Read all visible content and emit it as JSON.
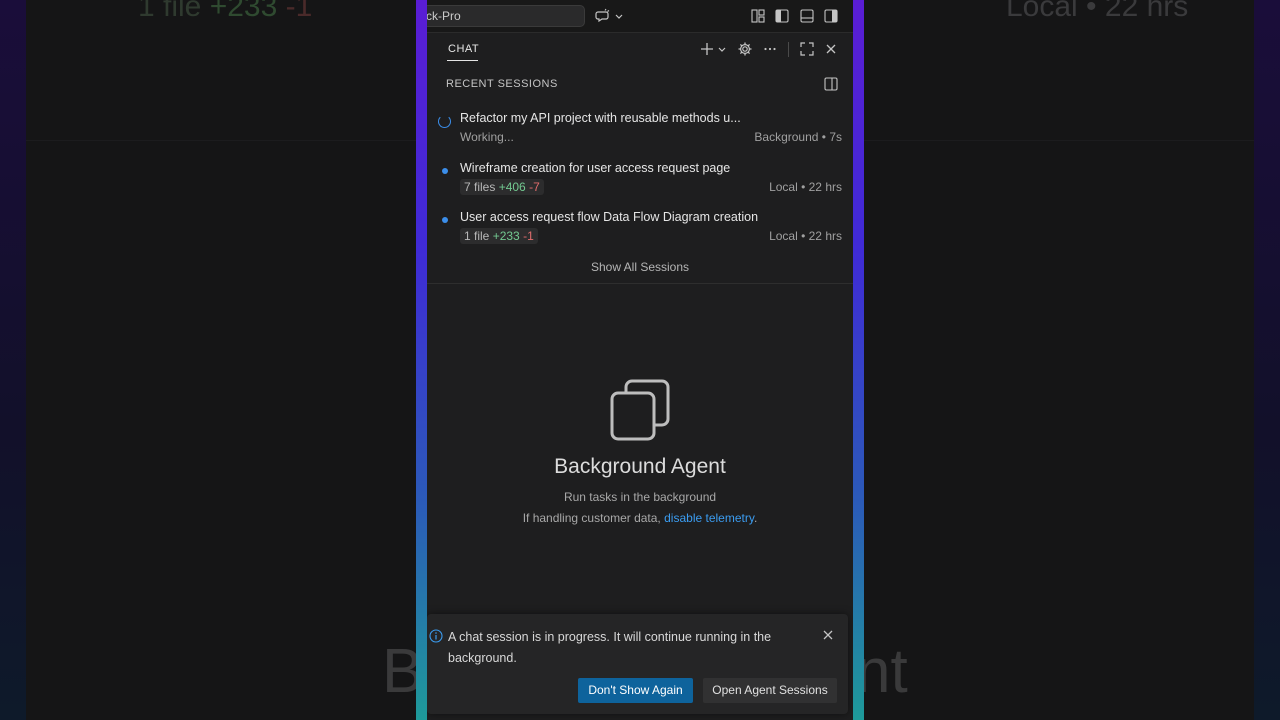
{
  "background": {
    "top_left": {
      "files": "1 file",
      "add": "+233",
      "del": "-1"
    },
    "top_right": "Local • 22 hrs",
    "bottom_left": "B",
    "bottom_right": "nt"
  },
  "titlebar": {
    "search_text": "ck-Pro"
  },
  "chat": {
    "tab_label": "CHAT",
    "section_title": "RECENT SESSIONS",
    "sessions": [
      {
        "title": "Refactor my API project with reusable methods u...",
        "status": "Working...",
        "meta": "Background • 7s",
        "state": "working"
      },
      {
        "title": "Wireframe creation for user access request page",
        "files": "7 files",
        "add": "+406",
        "del": "-7",
        "meta": "Local • 22 hrs",
        "state": "done"
      },
      {
        "title": "User access request flow Data Flow Diagram creation",
        "files": "1 file",
        "add": "+233",
        "del": "-1",
        "meta": "Local • 22 hrs",
        "state": "done"
      }
    ],
    "show_all": "Show All Sessions"
  },
  "agent": {
    "title": "Background Agent",
    "subtitle": "Run tasks in the background",
    "telemetry_prefix": "If handling customer data,",
    "telemetry_link": "disable telemetry",
    "telemetry_suffix": "."
  },
  "toast": {
    "message": "A chat session is in progress. It will continue running in the background.",
    "primary_button": "Don't Show Again",
    "secondary_button": "Open Agent Sessions"
  },
  "colors": {
    "accent": "#3b8eea",
    "primary_button": "#0e639c",
    "added": "#73c991",
    "removed": "#e06c6c",
    "link": "#3b9cf0"
  }
}
